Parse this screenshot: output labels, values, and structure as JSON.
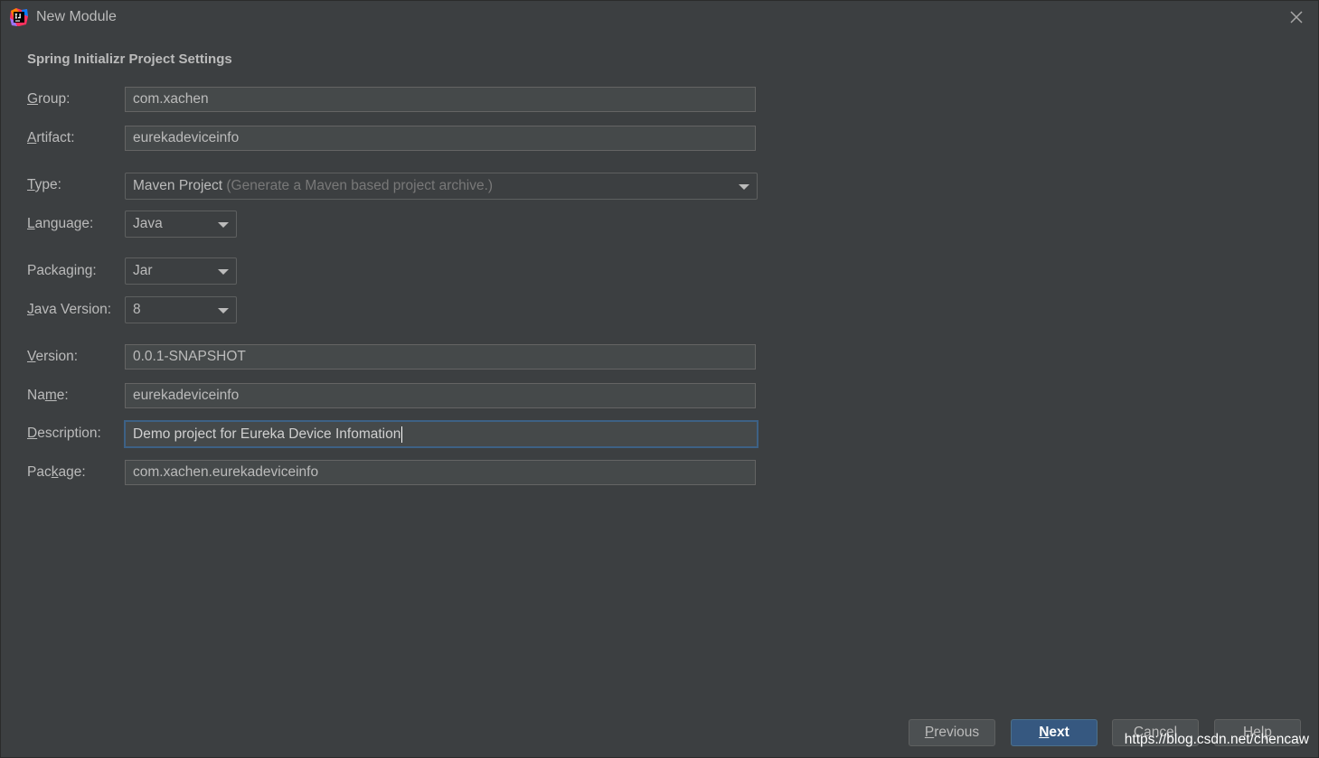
{
  "window": {
    "title": "New Module",
    "icon": "intellij-idea-icon",
    "close_icon": "close-icon"
  },
  "section_title": "Spring Initializr Project Settings",
  "fields": {
    "group": {
      "label_pre": "",
      "mnemonic": "G",
      "label_post": "roup:",
      "value": "com.xachen"
    },
    "artifact": {
      "label_pre": "",
      "mnemonic": "A",
      "label_post": "rtifact:",
      "value": "eurekadeviceinfo"
    },
    "type": {
      "label_pre": "",
      "mnemonic": "T",
      "label_post": "ype:",
      "value": "Maven Project",
      "hint": "(Generate a Maven based project archive.)"
    },
    "language": {
      "label_pre": "",
      "mnemonic": "L",
      "label_post": "anguage:",
      "value": "Java"
    },
    "packaging": {
      "label_pre": "Packa",
      "mnemonic": "g",
      "label_post": "ing:",
      "value": "Jar"
    },
    "java_version": {
      "label_pre": "",
      "mnemonic": "J",
      "label_post": "ava Version:",
      "value": "8"
    },
    "version": {
      "label_pre": "",
      "mnemonic": "V",
      "label_post": "ersion:",
      "value": "0.0.1-SNAPSHOT"
    },
    "name": {
      "label_pre": "Na",
      "mnemonic": "m",
      "label_post": "e:",
      "value": "eurekadeviceinfo"
    },
    "description": {
      "label_pre": "",
      "mnemonic": "D",
      "label_post": "escription:",
      "value": "Demo project for Eureka Device Infomation"
    },
    "package": {
      "label_pre": "Pac",
      "mnemonic": "k",
      "label_post": "age:",
      "value": "com.xachen.eurekadeviceinfo"
    }
  },
  "buttons": {
    "previous": {
      "mnemonic": "P",
      "rest": "revious"
    },
    "next": {
      "mnemonic": "N",
      "rest": "ext"
    },
    "cancel": {
      "mnemonic": "",
      "rest": "Cancel"
    },
    "help": {
      "mnemonic": "",
      "rest": "Help"
    }
  },
  "watermark": "https://blog.csdn.net/chencaw",
  "colors": {
    "background": "#3c3f41",
    "input_bg": "#45494a",
    "focus_border": "#3d6185",
    "primary_button": "#365880",
    "text": "#bbbbbb",
    "hint_text": "#787878"
  }
}
